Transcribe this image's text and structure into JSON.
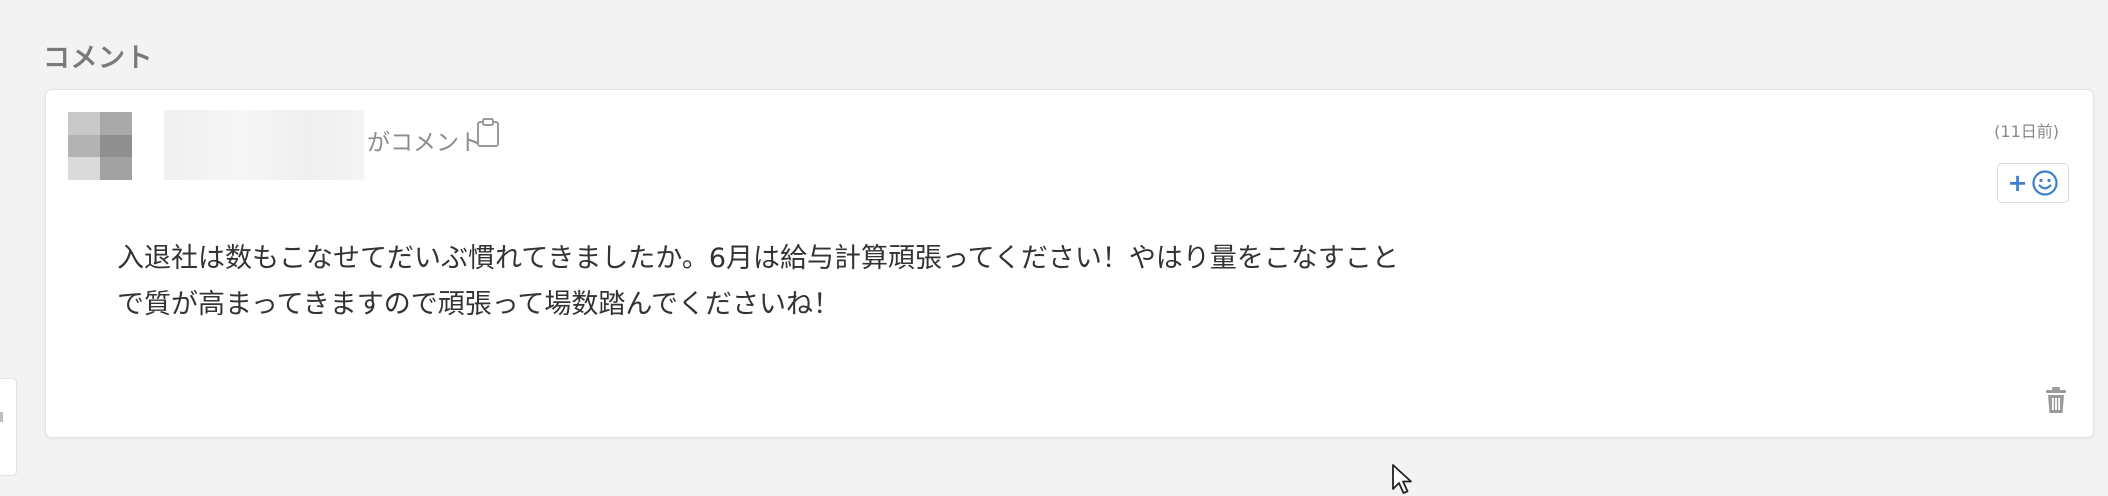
{
  "section": {
    "title": "コメント"
  },
  "comment": {
    "author_name": "",
    "commented_label": "がコメント",
    "timestamp": "(11日前)",
    "body_lines": [
      "入退社は数もこなせてだいぶ慣れてきましたか。6月は給与計算頑張ってください！やはり量をこなすこと",
      "で質が高まってきますので頑張って場数踏んでくださいね！"
    ],
    "reaction_button": {
      "plus": "+",
      "icon": "smiley-icon"
    },
    "icons": {
      "copy": "clipboard-icon",
      "delete": "trash-icon"
    }
  },
  "colors": {
    "page_background": "#f3f3f3",
    "card_background": "#ffffff",
    "accent": "#3d7fd1",
    "muted_text": "#8c8c8c",
    "body_text": "#333333"
  }
}
